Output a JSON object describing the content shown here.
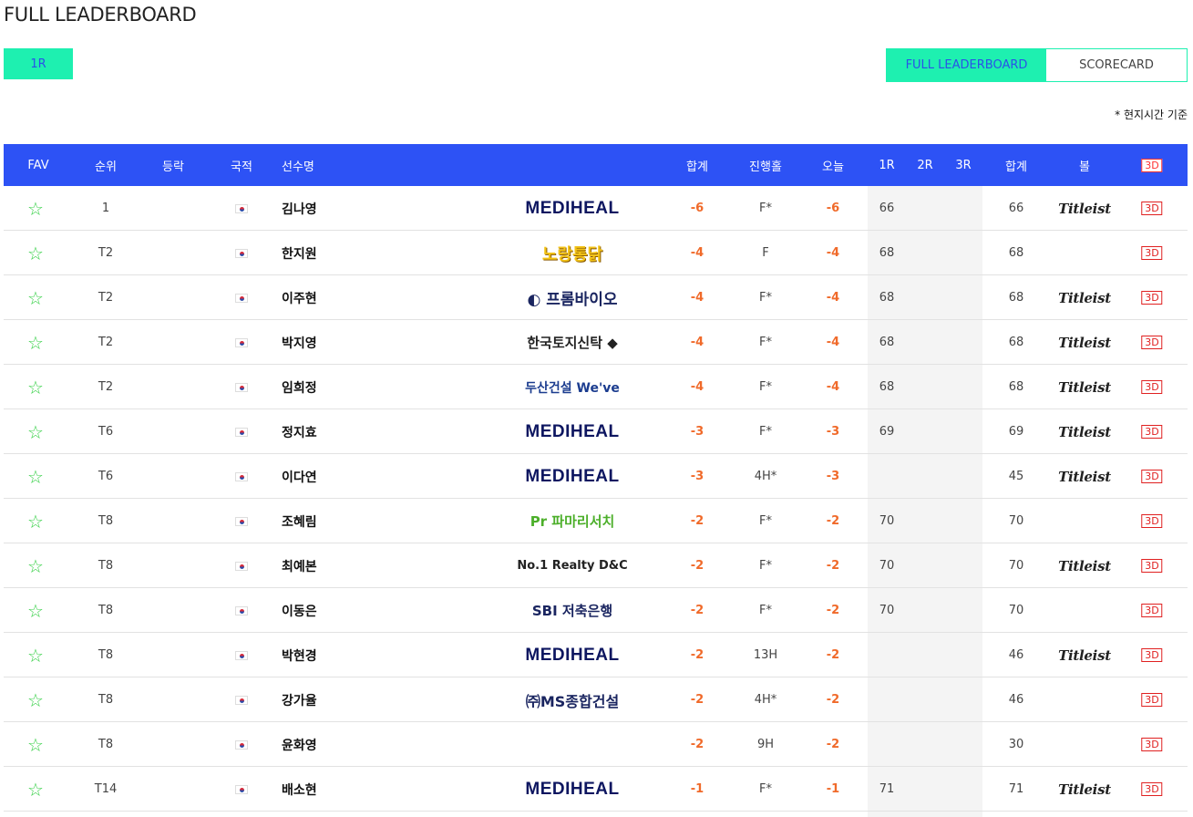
{
  "page": {
    "title": "FULL LEADERBOARD"
  },
  "round_tab": {
    "label": "1R"
  },
  "view_toggle": {
    "active_label": "FULL LEADERBOARD",
    "inactive_label": "SCORECARD"
  },
  "timezone_note": "* 현지시간 기준",
  "colors": {
    "header_bg": "#2d52f5",
    "accent": "#1ef0b0",
    "score": "#f06a2a",
    "star": "#3ad14a",
    "badge": "#e02020"
  },
  "columns": {
    "fav": "FAV",
    "rank": "순위",
    "move": "등락",
    "nation": "국적",
    "player": "선수명",
    "total": "합계",
    "thru": "진행홀",
    "today": "오늘",
    "r1": "1R",
    "r2": "2R",
    "r3": "3R",
    "strokes": "합계",
    "ball": "볼",
    "view3d": "3D"
  },
  "players": [
    {
      "rank": "1",
      "name": "김나영",
      "sponsor": "MEDIHEAL",
      "sponsor_style": "mediheal",
      "total": "-6",
      "thru": "F*",
      "today": "-6",
      "r1": "66",
      "strokes": "66",
      "ball": "Titleist",
      "view3d": "3D"
    },
    {
      "rank": "T2",
      "name": "한지원",
      "sponsor": "노랑통닭",
      "sponsor_style": "yellow",
      "total": "-4",
      "thru": "F",
      "today": "-4",
      "r1": "68",
      "strokes": "68",
      "ball": "",
      "view3d": "3D"
    },
    {
      "rank": "T2",
      "name": "이주현",
      "sponsor": "◐ 프롬바이오",
      "sponsor_style": "navy",
      "total": "-4",
      "thru": "F*",
      "today": "-4",
      "r1": "68",
      "strokes": "68",
      "ball": "Titleist",
      "view3d": "3D"
    },
    {
      "rank": "T2",
      "name": "박지영",
      "sponsor": "한국토지신탁 ◆",
      "sponsor_style": "land",
      "total": "-4",
      "thru": "F*",
      "today": "-4",
      "r1": "68",
      "strokes": "68",
      "ball": "Titleist",
      "view3d": "3D"
    },
    {
      "rank": "T2",
      "name": "임희정",
      "sponsor": "두산건설 We've",
      "sponsor_style": "doosan",
      "total": "-4",
      "thru": "F*",
      "today": "-4",
      "r1": "68",
      "strokes": "68",
      "ball": "Titleist",
      "view3d": "3D"
    },
    {
      "rank": "T6",
      "name": "정지효",
      "sponsor": "MEDIHEAL",
      "sponsor_style": "mediheal",
      "total": "-3",
      "thru": "F*",
      "today": "-3",
      "r1": "69",
      "strokes": "69",
      "ball": "Titleist",
      "view3d": "3D"
    },
    {
      "rank": "T6",
      "name": "이다연",
      "sponsor": "MEDIHEAL",
      "sponsor_style": "mediheal",
      "total": "-3",
      "thru": "4H*",
      "today": "-3",
      "r1": "",
      "strokes": "45",
      "ball": "Titleist",
      "view3d": "3D"
    },
    {
      "rank": "T8",
      "name": "조혜림",
      "sponsor": "Pr 파마리서치",
      "sponsor_style": "green",
      "total": "-2",
      "thru": "F*",
      "today": "-2",
      "r1": "70",
      "strokes": "70",
      "ball": "",
      "view3d": "3D"
    },
    {
      "rank": "T8",
      "name": "최예본",
      "sponsor": "No.1 Realty D&C",
      "sponsor_style": "realty",
      "total": "-2",
      "thru": "F*",
      "today": "-2",
      "r1": "70",
      "strokes": "70",
      "ball": "Titleist",
      "view3d": "3D"
    },
    {
      "rank": "T8",
      "name": "이동은",
      "sponsor": "SBI 저축은행",
      "sponsor_style": "sbi",
      "total": "-2",
      "thru": "F*",
      "today": "-2",
      "r1": "70",
      "strokes": "70",
      "ball": "",
      "view3d": "3D"
    },
    {
      "rank": "T8",
      "name": "박현경",
      "sponsor": "MEDIHEAL",
      "sponsor_style": "mediheal",
      "total": "-2",
      "thru": "13H",
      "today": "-2",
      "r1": "",
      "strokes": "46",
      "ball": "Titleist",
      "view3d": "3D"
    },
    {
      "rank": "T8",
      "name": "강가율",
      "sponsor": "㈜MS종합건설",
      "sponsor_style": "ms",
      "total": "-2",
      "thru": "4H*",
      "today": "-2",
      "r1": "",
      "strokes": "46",
      "ball": "",
      "view3d": "3D"
    },
    {
      "rank": "T8",
      "name": "윤화영",
      "sponsor": "",
      "sponsor_style": "",
      "total": "-2",
      "thru": "9H",
      "today": "-2",
      "r1": "",
      "strokes": "30",
      "ball": "",
      "view3d": "3D"
    },
    {
      "rank": "T14",
      "name": "배소현",
      "sponsor": "MEDIHEAL",
      "sponsor_style": "mediheal",
      "total": "-1",
      "thru": "F*",
      "today": "-1",
      "r1": "71",
      "strokes": "71",
      "ball": "Titleist",
      "view3d": "3D"
    }
  ]
}
